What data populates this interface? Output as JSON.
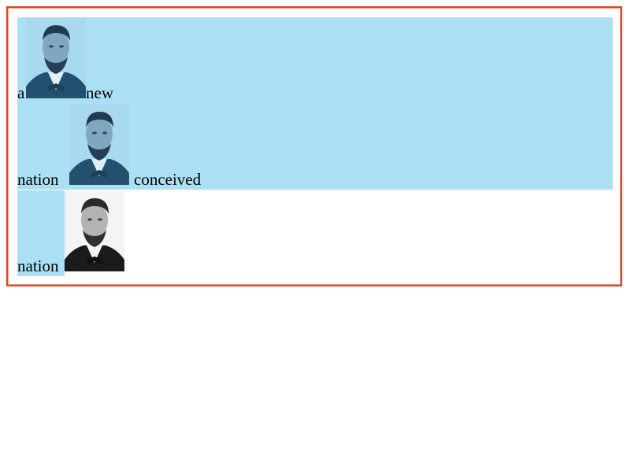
{
  "lines": [
    {
      "words": [
        "a",
        "new"
      ]
    },
    {
      "words": [
        "nation",
        "conceived"
      ]
    },
    {
      "words": [
        "nation"
      ]
    }
  ],
  "images": [
    {
      "icon": "portrait-photo",
      "tint": "#4a7fa3"
    },
    {
      "icon": "portrait-photo",
      "tint": "#4a7fa3"
    },
    {
      "icon": "portrait-photo",
      "tint": "#2a2a2a"
    }
  ],
  "colors": {
    "highlight": "#abdff4",
    "border": "#e8411b"
  }
}
